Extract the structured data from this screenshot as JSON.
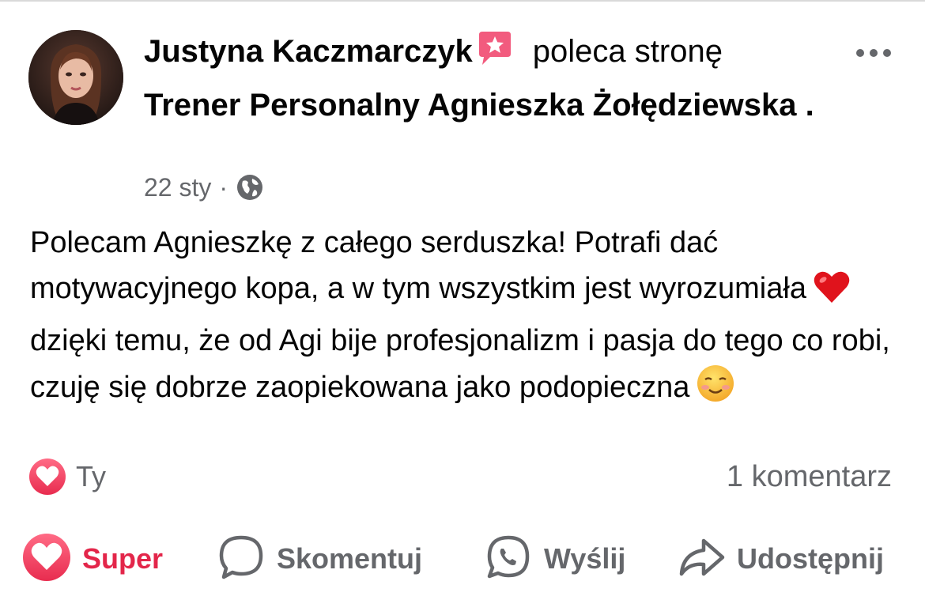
{
  "post": {
    "author": "Justyna Kaczmarczyk",
    "verb": "poleca stronę",
    "page_name": "Trener Personalny Agnieszka Żołędziewska",
    "page_suffix": " .",
    "date": "22 sty",
    "separator": "·",
    "audience_icon": "globe-icon",
    "more_icon": "more-options-icon",
    "body_1": "Polecam Agnieszkę z całego serduszka! Potrafi dać motywacyjnego kopa, a w tym wszystkim jest wyrozumiała",
    "body_2": "dzięki temu, że od Agi bije profesjonalizm i pasja do tego co robi, czuję się dobrze zaopiekowana jako podopieczna",
    "emoji_1": "red-heart-emoji",
    "emoji_2": "smiling-face-emoji"
  },
  "reactions": {
    "icon": "love-reaction-icon",
    "by": "Ty",
    "comments": "1 komentarz"
  },
  "actions": {
    "super": "Super",
    "comment": "Skomentuj",
    "send": "Wyślij",
    "share": "Udostępnij"
  },
  "colors": {
    "accent_red": "#e3264a",
    "muted_text": "#65676b",
    "text": "#050505"
  }
}
